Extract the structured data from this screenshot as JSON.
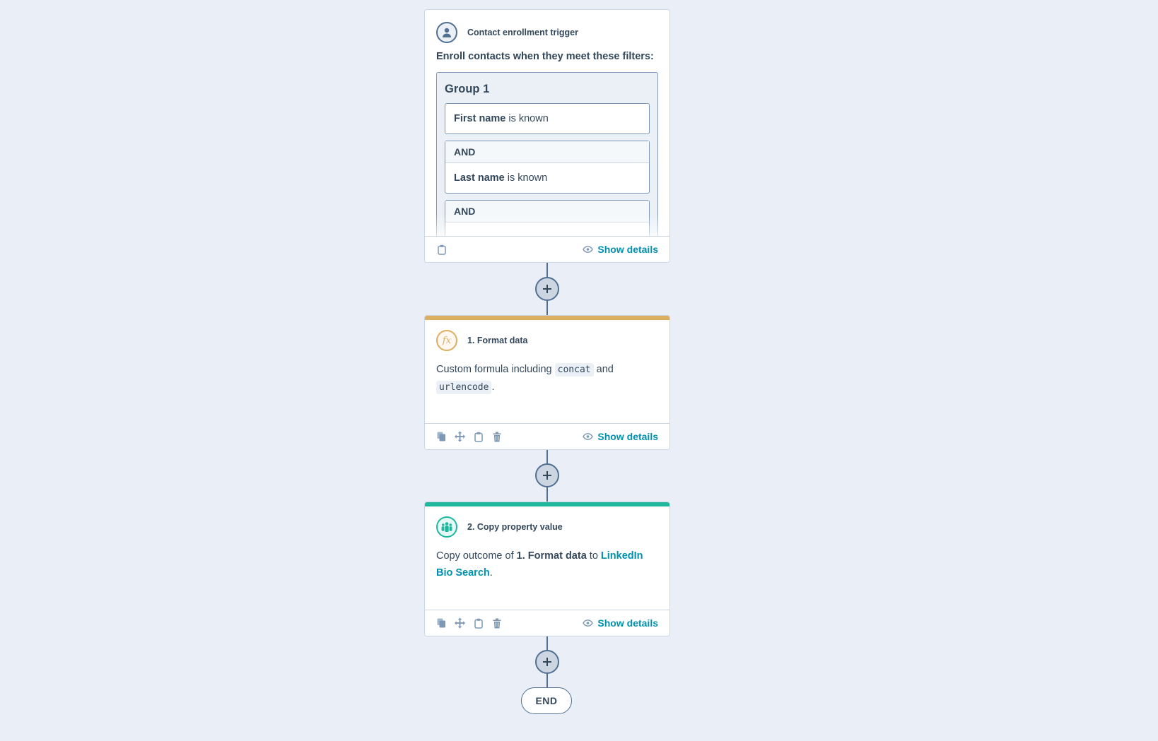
{
  "trigger": {
    "title": "Contact enrollment trigger",
    "icon": "contact-icon",
    "lead": "Enroll contacts when they meet these filters:",
    "group": {
      "title": "Group 1",
      "filters": [
        {
          "property": "First name",
          "condition": " is known"
        },
        {
          "connector": "AND",
          "property": "Last name",
          "condition": " is known"
        },
        {
          "connector": "AND"
        }
      ]
    },
    "show_details": "Show details"
  },
  "actions": [
    {
      "title": "1. Format data",
      "icon": "function-icon",
      "icon_glyph": "fx",
      "accent": "#dbae60",
      "text_before": "Custom formula including ",
      "code1": "concat",
      "text_mid": " and ",
      "code2": "urlencode",
      "text_after": ".",
      "show_details": "Show details"
    },
    {
      "title": "2. Copy property value",
      "icon": "copy-property-icon",
      "accent": "#1fb89f",
      "text_before": "Copy outcome of ",
      "bold": "1. Format data",
      "text_mid": " to ",
      "link": "LinkedIn Bio Search",
      "text_after": ".",
      "show_details": "Show details"
    }
  ],
  "end_label": "END",
  "colors": {
    "background": "#eaeff7",
    "link": "#0091ae",
    "text": "#33475b",
    "connector": "#516f90"
  }
}
